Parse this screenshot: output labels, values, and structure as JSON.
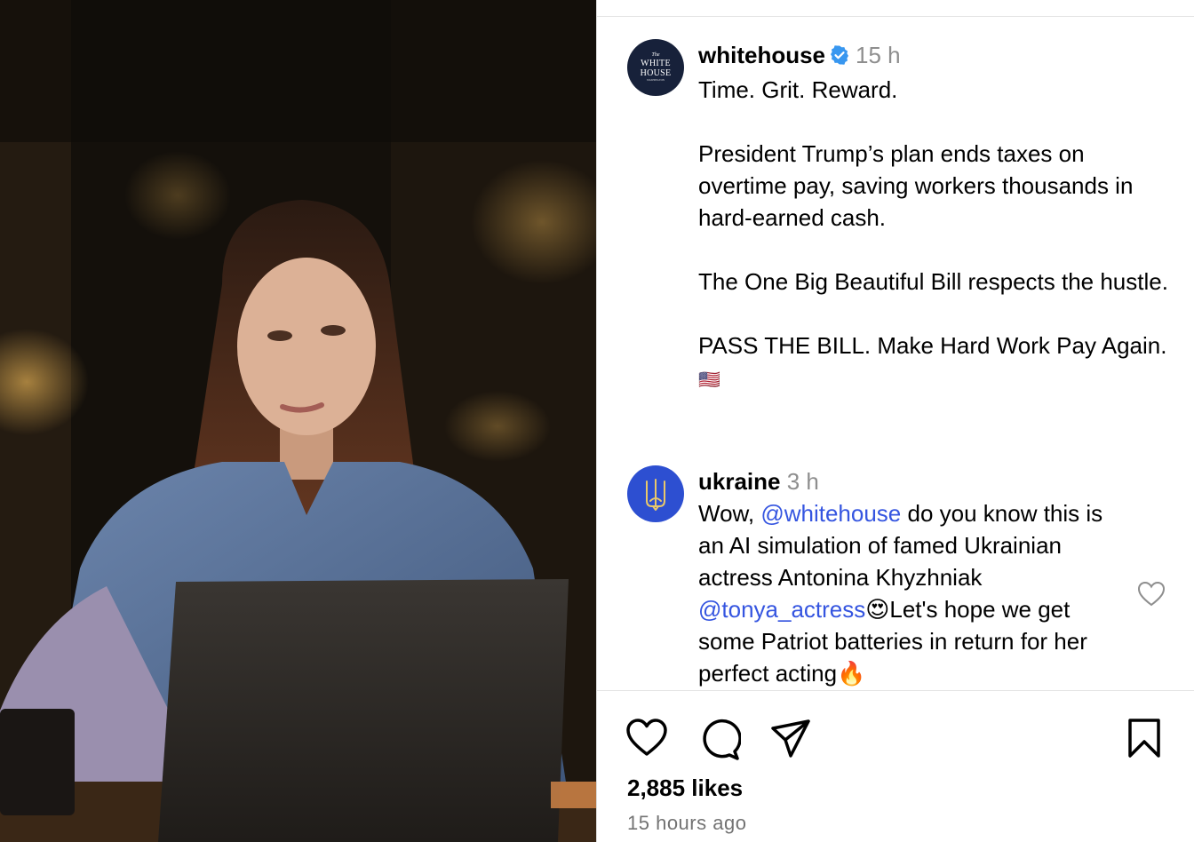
{
  "post": {
    "author": {
      "username": "whitehouse",
      "time": "15 h",
      "avatar_text": {
        "the": "The",
        "line1": "WHITE",
        "line2": "HOUSE",
        "sub": "WASHINGTON"
      },
      "verified_icon": "verified-badge-icon",
      "accent_color": "#3897f0"
    },
    "caption": {
      "line1": "Time. Grit. Reward.",
      "para2": "President Trump’s plan ends taxes on overtime pay, saving workers thousands in hard-earned cash.",
      "para3": "The One Big Beautiful Bill respects the hustle.",
      "para4_text": "PASS THE BILL. Make Hard Work Pay Again.",
      "para4_emoji": "🇺🇸"
    },
    "comment": {
      "username": "ukraine",
      "time": "3 h",
      "part1": "Wow, ",
      "mention1": "@whitehouse",
      "part2": " do you know this is an AI simulation of famed Ukrainian actress Antonina Khyzhniak ",
      "mention2": "@tonya_actress",
      "part3": "😍Let's hope we get some Patriot batteries in return for her perfect acting🔥",
      "like_icon": "heart-outline-icon"
    },
    "actions": {
      "icons": [
        "heart-icon",
        "comment-icon",
        "share-icon",
        "bookmark-icon"
      ]
    },
    "likes_text": "2,885 likes",
    "posted_ago": "15 hours ago",
    "media": {
      "description_icon": "video-frame"
    }
  }
}
